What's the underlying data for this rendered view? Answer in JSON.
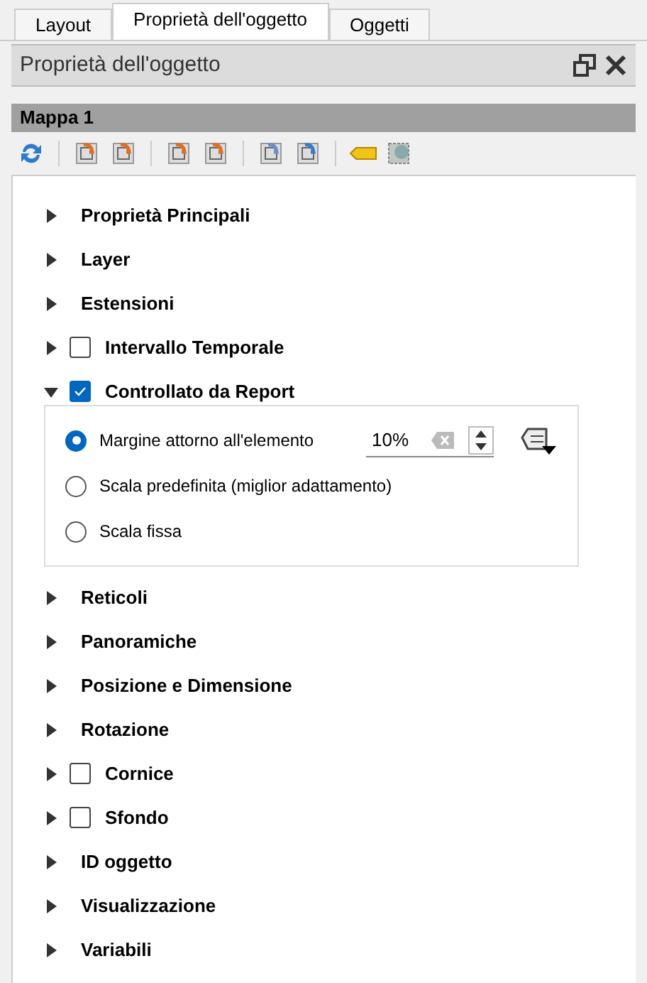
{
  "tabs": [
    {
      "label": "Layout",
      "selected": false
    },
    {
      "label": "Proprietà dell'oggetto",
      "selected": true
    },
    {
      "label": "Oggetti",
      "selected": false
    }
  ],
  "panel": {
    "title": "Proprietà dell'oggetto"
  },
  "item_header": "Mappa 1",
  "sections": [
    {
      "kind": "plain",
      "label": "Proprietà Principali",
      "expanded": false
    },
    {
      "kind": "plain",
      "label": "Layer",
      "expanded": false
    },
    {
      "kind": "plain",
      "label": "Estensioni",
      "expanded": false
    },
    {
      "kind": "checkbox",
      "label": "Intervallo Temporale",
      "expanded": false,
      "checked": false
    },
    {
      "kind": "checkbox",
      "label": "Controllato da Report",
      "expanded": true,
      "checked": true,
      "options": [
        {
          "label": "Margine attorno all'elemento",
          "selected": true,
          "value": "10%"
        },
        {
          "label": "Scala predefinita (miglior adattamento)",
          "selected": false
        },
        {
          "label": "Scala fissa",
          "selected": false
        }
      ]
    },
    {
      "kind": "plain",
      "label": "Reticoli",
      "expanded": false
    },
    {
      "kind": "plain",
      "label": "Panoramiche",
      "expanded": false
    },
    {
      "kind": "plain",
      "label": "Posizione e Dimensione",
      "expanded": false
    },
    {
      "kind": "plain",
      "label": "Rotazione",
      "expanded": false
    },
    {
      "kind": "checkbox",
      "label": "Cornice",
      "expanded": false,
      "checked": false
    },
    {
      "kind": "checkbox",
      "label": "Sfondo",
      "expanded": false,
      "checked": false
    },
    {
      "kind": "plain",
      "label": "ID oggetto",
      "expanded": false
    },
    {
      "kind": "plain",
      "label": "Visualizzazione",
      "expanded": false
    },
    {
      "kind": "plain",
      "label": "Variabili",
      "expanded": false
    }
  ]
}
